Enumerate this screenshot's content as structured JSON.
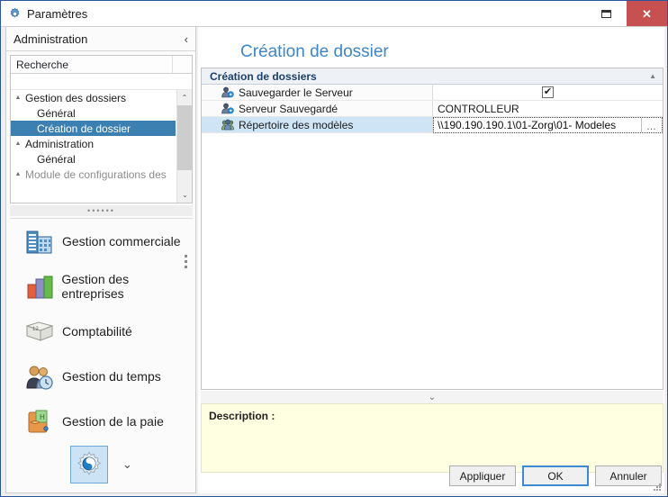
{
  "window": {
    "title": "Paramètres",
    "gear_icon": "gear-icon",
    "restore_label": "",
    "close_label": "✕"
  },
  "left_panel": {
    "header_title": "Administration",
    "collapse_icon": "‹",
    "search": {
      "column_header": "Recherche",
      "filter_value": ""
    },
    "tree": [
      {
        "label": "Gestion des dossiers",
        "indent": 0,
        "expander": "▲",
        "selected": false,
        "partial": false
      },
      {
        "label": "Général",
        "indent": 1,
        "expander": "",
        "selected": false,
        "partial": false
      },
      {
        "label": "Création de dossier",
        "indent": 1,
        "expander": "",
        "selected": true,
        "partial": false
      },
      {
        "label": "Administration",
        "indent": 0,
        "expander": "▲",
        "selected": false,
        "partial": false
      },
      {
        "label": "Général",
        "indent": 1,
        "expander": "",
        "selected": false,
        "partial": false
      },
      {
        "label": "Module de configurations des",
        "indent": 0,
        "expander": "▲",
        "selected": false,
        "partial": true
      }
    ],
    "scroll_up": "⌃",
    "scroll_down": "⌄",
    "splitter_dots": "••••••",
    "nav_items": [
      {
        "label": "Gestion commerciale",
        "icon": "building-icon"
      },
      {
        "label": "Gestion des entreprises",
        "icon": "bar-blocks-icon"
      },
      {
        "label": "Comptabilité",
        "icon": "ledger-book-icon"
      },
      {
        "label": "Gestion du temps",
        "icon": "people-clock-icon"
      },
      {
        "label": "Gestion de la paie",
        "icon": "payroll-wallet-icon"
      }
    ],
    "settings_button_icon": "settings-gear-icon",
    "settings_chevron": "⌄"
  },
  "main": {
    "page_title": "Création de dossier",
    "grid": {
      "group_title": "Création de dossiers",
      "group_collapse_icon": "▲",
      "rows": [
        {
          "name": "Sauvegarder le Serveur",
          "icon": "user-gear-icon",
          "type": "checkbox",
          "checked": true,
          "check_glyph": "✔",
          "value": "",
          "selected": false
        },
        {
          "name": "Serveur Sauvegardé",
          "icon": "user-gear-icon",
          "type": "text",
          "value": "CONTROLLEUR",
          "selected": false
        },
        {
          "name": "Répertoire des modèles",
          "icon": "users-group-icon",
          "type": "path-editor",
          "value": "\\\\190.190.190.1\\01-Zorg\\01- Modeles",
          "browse_label": "…",
          "selected": true
        }
      ]
    },
    "description": {
      "splitter_icon": "⌄",
      "label": "Description :",
      "text": ""
    },
    "buttons": {
      "apply": "Appliquer",
      "ok": "OK",
      "cancel": "Annuler"
    }
  },
  "colors": {
    "window_border": "#2b579a",
    "title_accent": "#3f86c4",
    "close_button": "#c75050",
    "tree_selection": "#3c7fb1",
    "row_selection": "#cfe4f5",
    "description_bg": "#ffffe1",
    "focus_border": "#3c8bd0"
  }
}
